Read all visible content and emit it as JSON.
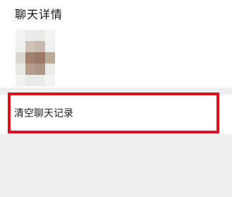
{
  "header": {
    "title": "聊天详情"
  },
  "member": {
    "avatar_icon": "member-avatar-pixelated"
  },
  "actions": {
    "clear_history_label": "清空聊天记录"
  },
  "colors": {
    "highlight": "#e10f1d",
    "background": "#efefef",
    "panel": "#ffffff"
  }
}
